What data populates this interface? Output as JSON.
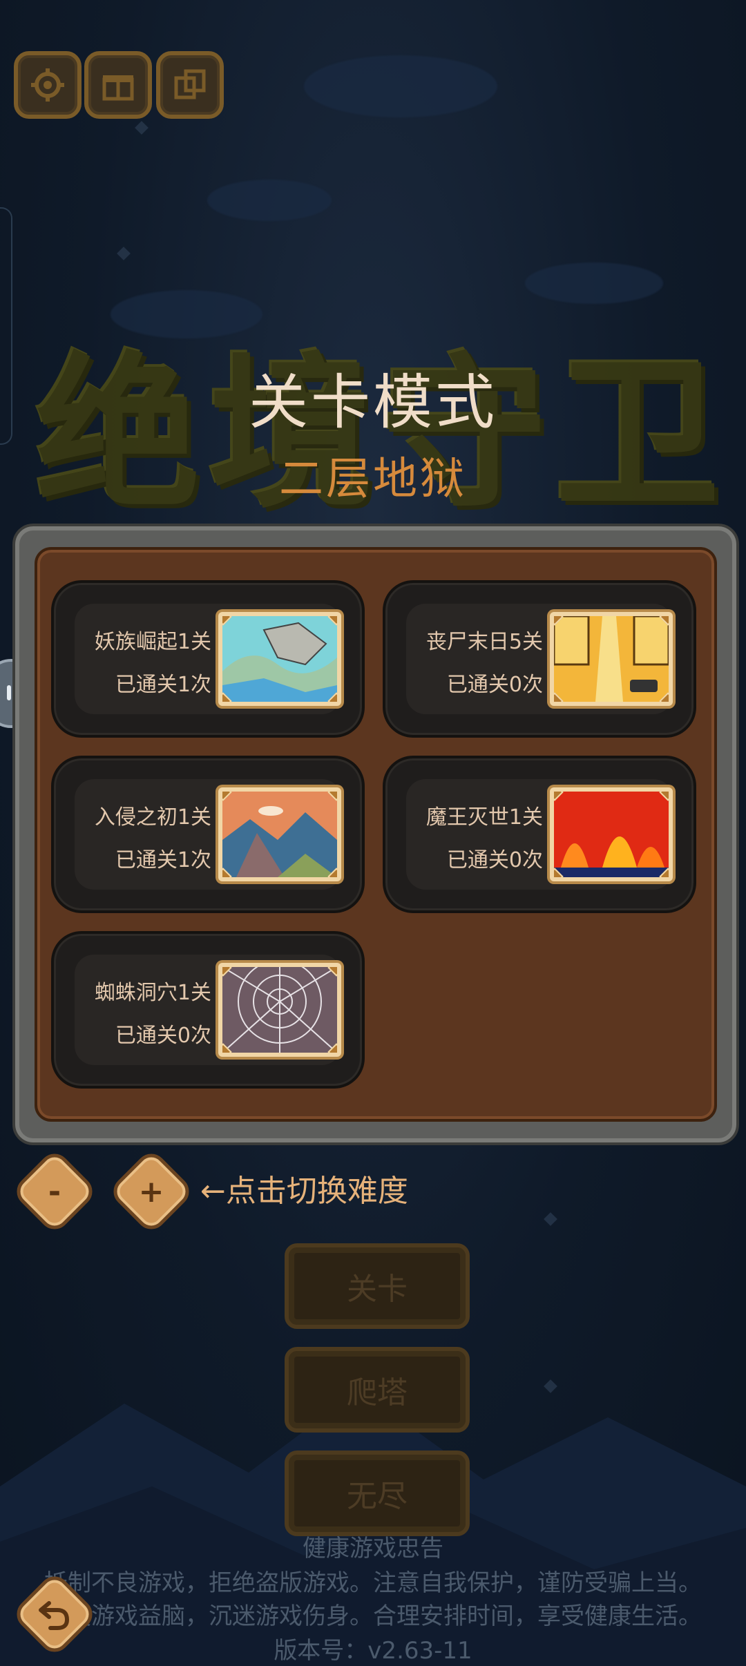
{
  "header": {
    "icons": [
      "gear-icon",
      "gift-icon",
      "copy-icon"
    ],
    "bg_title_chars": [
      "绝",
      "境",
      "守",
      "卫"
    ]
  },
  "title": {
    "main": "关卡模式",
    "sub": "二层地狱"
  },
  "levels": [
    {
      "name": "妖族崛起1关",
      "cleared": "已通关1次"
    },
    {
      "name": "丧尸末日5关",
      "cleared": "已通关0次"
    },
    {
      "name": "入侵之初1关",
      "cleared": "已通关1次"
    },
    {
      "name": "魔王灭世1关",
      "cleared": "已通关0次"
    },
    {
      "name": "蜘蛛洞穴1关",
      "cleared": "已通关0次"
    }
  ],
  "difficulty": {
    "minus_label": "-",
    "plus_label": "+",
    "hint": "←点击切换难度"
  },
  "modes": {
    "level": "关卡",
    "tower": "爬塔",
    "endless": "无尽"
  },
  "footer": {
    "advisory_title": "健康游戏忠告",
    "line1": "抵制不良游戏，拒绝盗版游戏。注意自我保护，谨防受骗上当。",
    "line2": "适度游戏益脑，沉迷游戏伤身。合理安排时间，享受健康生活。",
    "version": "版本号：v2.63-11"
  },
  "colors": {
    "panel_brown": "#5c361f",
    "accent_orange": "#d68a3c",
    "button_gold": "#d39a5a"
  }
}
